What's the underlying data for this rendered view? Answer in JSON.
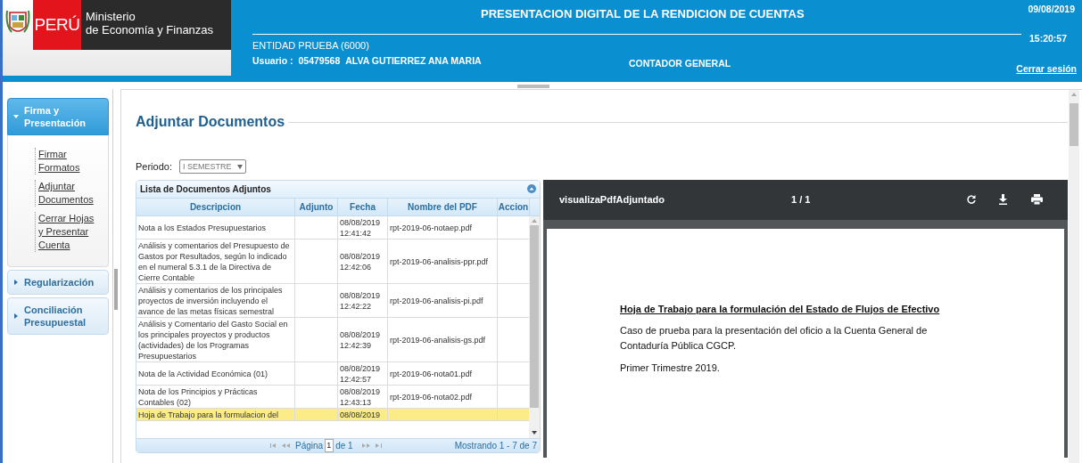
{
  "header": {
    "logo_text": "PERÚ",
    "ministry": [
      "Ministerio",
      "de Economía y Finanzas"
    ],
    "title": "PRESENTACION DIGITAL DE LA RENDICION DE CUENTAS",
    "entity": "ENTIDAD PRUEBA (6000)",
    "user_label": "Usuario :",
    "user_id": "05479568",
    "user_name": "ALVA GUTIERREZ ANA MARIA",
    "role": "CONTADOR GENERAL",
    "date": "09/08/2019",
    "time": "15:20:57",
    "logout": "Cerrar sesión"
  },
  "sidebar": {
    "sections": [
      {
        "label": "Firma y Presentación",
        "expanded": true,
        "items": [
          {
            "label": "Firmar Formatos"
          },
          {
            "label": "Adjuntar Documentos"
          },
          {
            "label": "Cerrar Hojas y Presentar Cuenta"
          }
        ]
      },
      {
        "label": "Regularización",
        "expanded": false
      },
      {
        "label": "Conciliación Presupuestal",
        "expanded": false
      }
    ]
  },
  "main": {
    "title": "Adjuntar Documentos",
    "period_label": "Periodo:",
    "period_value": "I SEMESTRE",
    "grid": {
      "caption": "Lista de Documentos Adjuntos",
      "columns": [
        "Descripcion",
        "Adjunto",
        "Fecha",
        "Nombre del PDF",
        "Accion"
      ],
      "rows": [
        {
          "descripcion": "Nota a los Estados Presupuestarios",
          "fecha": "08/08/2019 12:41:42",
          "pdf": "rpt-2019-06-notaep.pdf",
          "selected": false
        },
        {
          "descripcion": "Análisis y comentarios del Presupuesto de Gastos por Resultados, según lo indicado en el numeral 5.3.1 de la Directiva de Cierre Contable",
          "fecha": "08/08/2019 12:42:06",
          "pdf": "rpt-2019-06-analisis-ppr.pdf",
          "selected": false
        },
        {
          "descripcion": "Análisis y comentarios de los principales proyectos de inversión incluyendo el avance de las metas físicas semestral",
          "fecha": "08/08/2019 12:42:22",
          "pdf": "rpt-2019-06-analisis-pi.pdf",
          "selected": false
        },
        {
          "descripcion": "Análisis y Comentario del Gasto Social en los principales proyectos y productos (actividades) de los Programas Presupuestarios",
          "fecha": "08/08/2019 12:42:39",
          "pdf": "rpt-2019-06-analisis-gs.pdf",
          "selected": false
        },
        {
          "descripcion": "Nota de la Actividad Económica (01)",
          "fecha": "08/08/2019 12:42:57",
          "pdf": "rpt-2019-06-nota01.pdf",
          "selected": false
        },
        {
          "descripcion": "Nota de los Principios y Prácticas Contables (02)",
          "fecha": "08/08/2019 12:43:13",
          "pdf": "rpt-2019-06-nota02.pdf",
          "selected": false
        },
        {
          "descripcion": "Hoja de Trabajo para la formulacion del",
          "fecha": "08/08/2019",
          "pdf": "",
          "selected": true
        }
      ],
      "pager": {
        "page_label": "Página",
        "page": "1",
        "of": "de 1",
        "summary": "Mostrando 1 - 7 de 7"
      }
    },
    "pdf_viewer": {
      "title": "visualizaPdfAdjuntado",
      "pages": "1 / 1",
      "document": {
        "heading": "Hoja de Trabajo para la formulación del Estado de Flujos de Efectivo",
        "paragraphs": [
          "Caso de prueba para la presentación del oficio a la Cuenta General de Contaduría Pública CGCP.",
          "Primer Trimestre  2019."
        ]
      }
    }
  }
}
